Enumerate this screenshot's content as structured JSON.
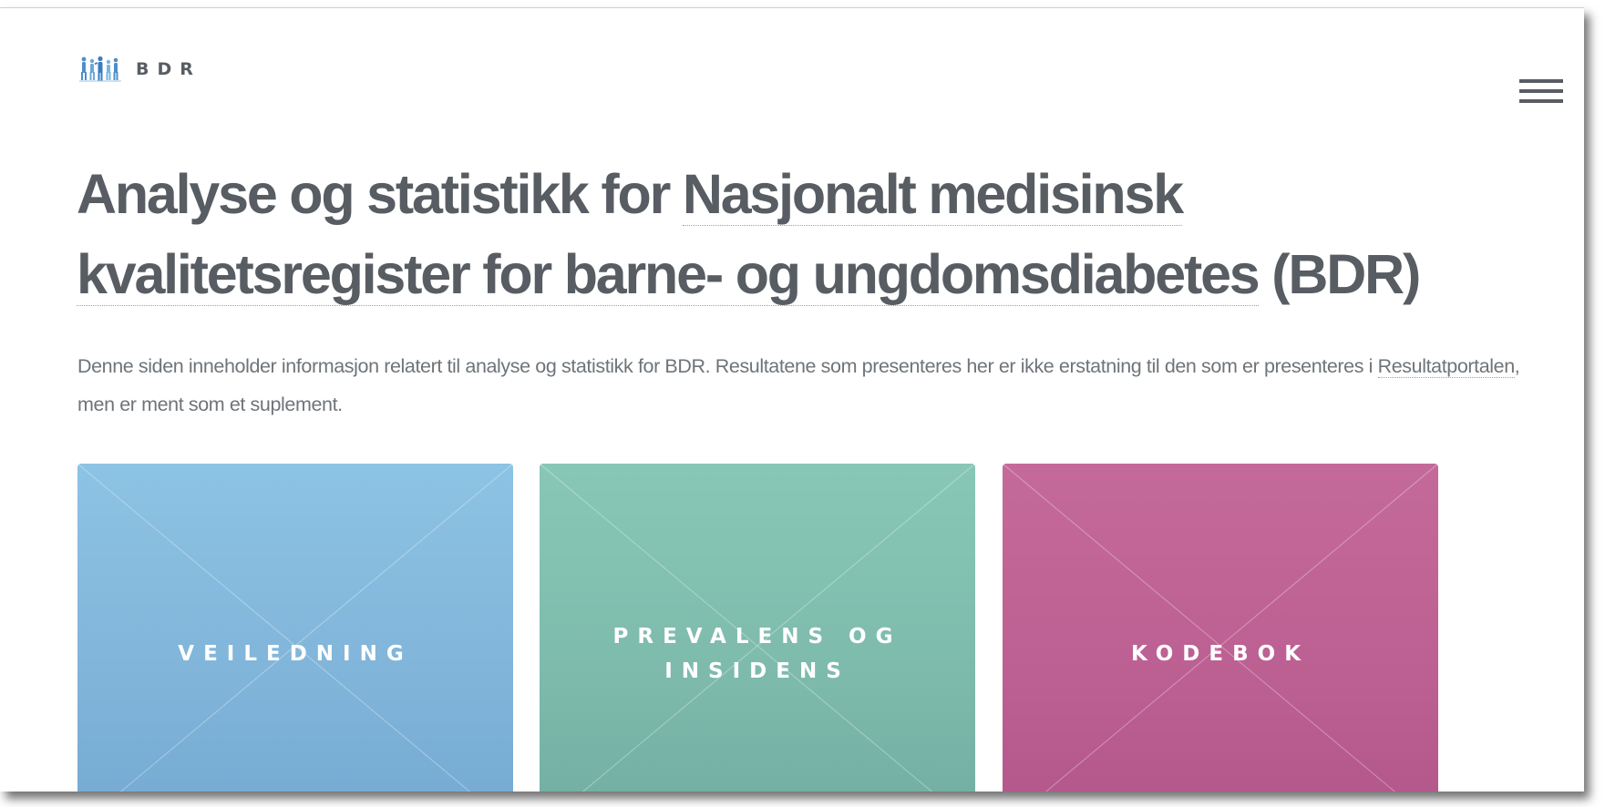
{
  "header": {
    "logo_text": "BDR",
    "logo_icon": "children-figures-logo",
    "menu_icon": "hamburger-menu-icon"
  },
  "hero": {
    "title_prefix": "Analyse og statistikk for ",
    "title_link": "Nasjonalt medisinsk kvalitetsregister for barne- og ungdomsdiabetes",
    "title_suffix": " (BDR)"
  },
  "intro": {
    "text_before": "Denne siden inneholder informasjon relatert til analyse og statistikk for BDR. Resultatene som presenteres her er ikke erstatning til den som er presenteres i ",
    "link": "Resultatportalen",
    "text_after": ", men er ment som et suplement."
  },
  "tiles": [
    {
      "label": "VEILEDNING",
      "color": "#86bbdf"
    },
    {
      "label": "PREVALENS OG INSIDENS",
      "color": "#7fbeae"
    },
    {
      "label": "KODEBOK",
      "color": "#bf6394"
    }
  ],
  "colors": {
    "text": "#585d63",
    "muted_text": "#6e7479",
    "background": "#ffffff"
  }
}
